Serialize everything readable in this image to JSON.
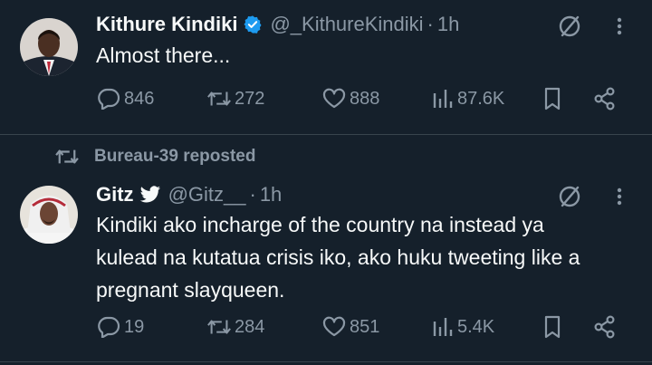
{
  "tweets": [
    {
      "display_name": "Kithure Kindiki",
      "verified": true,
      "handle": "@_KithureKindiki",
      "separator": "·",
      "time": "1h",
      "text": "Almost there...",
      "replies": "846",
      "reposts": "272",
      "likes": "888",
      "views": "87.6K"
    },
    {
      "repost_label": "Bureau-39 reposted",
      "display_name": "Gitz",
      "handle": "@Gitz__",
      "separator": "·",
      "time": "1h",
      "text": "Kindiki ako incharge of the country na instead ya\nkulead na kutatua crisis iko, ako huku tweeting like a\npregnant slayqueen.",
      "replies": "19",
      "reposts": "284",
      "likes": "851",
      "views": "5.4K"
    }
  ],
  "icons": {
    "reply": "reply-icon",
    "repost": "repost-icon",
    "like": "heart-icon",
    "views": "views-icon",
    "bookmark": "bookmark-icon",
    "share": "share-icon",
    "grok": "grok-icon",
    "more": "more-icon",
    "verified": "verified-badge-icon",
    "twitter_blue": "bird-badge-icon"
  },
  "colors": {
    "background": "#15202b",
    "text": "#f7f9f9",
    "secondary": "#8b98a5",
    "verified": "#1d9bf0",
    "divider": "#38444d"
  }
}
